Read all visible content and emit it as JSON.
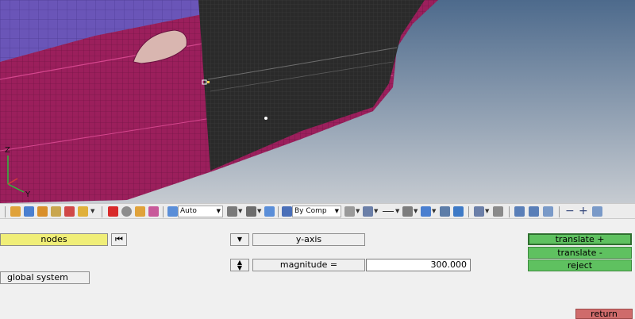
{
  "viewport": {
    "triad": {
      "z": "Z",
      "y": "Y"
    },
    "colors": {
      "background_top": "#4d6a8c",
      "background_bottom": "#c6cbd1",
      "panel": "#9b1f5c",
      "door": "#2a2a2a",
      "roof": "#6a55b8"
    }
  },
  "toolbar": {
    "display_mode": "Auto",
    "color_mode": "By Comp",
    "icons": [
      "solid-box-icon",
      "wire-box-icon",
      "component-icon",
      "box-icon",
      "hide-icon",
      "show-icon",
      "delete-icon",
      "sphere-icon",
      "mask-icon",
      "pen-icon",
      "cone-icon",
      "iso-view-icon",
      "cube-icon",
      "shade-icon",
      "mesh-icon",
      "surface-icon",
      "display-icon",
      "monitor-icon",
      "grid-icon",
      "wrench-icon",
      "back-icon",
      "forward-icon",
      "undo-icon",
      "minus-icon",
      "plus-icon",
      "redo-icon"
    ]
  },
  "panel": {
    "entity_selector": "nodes",
    "system_button": "global system",
    "direction_selector": "y-axis",
    "magnitude_label": "magnitude =",
    "magnitude_value": "300.000",
    "translate_plus": "translate +",
    "translate_minus": "translate -",
    "reject": "reject",
    "return": "return"
  }
}
